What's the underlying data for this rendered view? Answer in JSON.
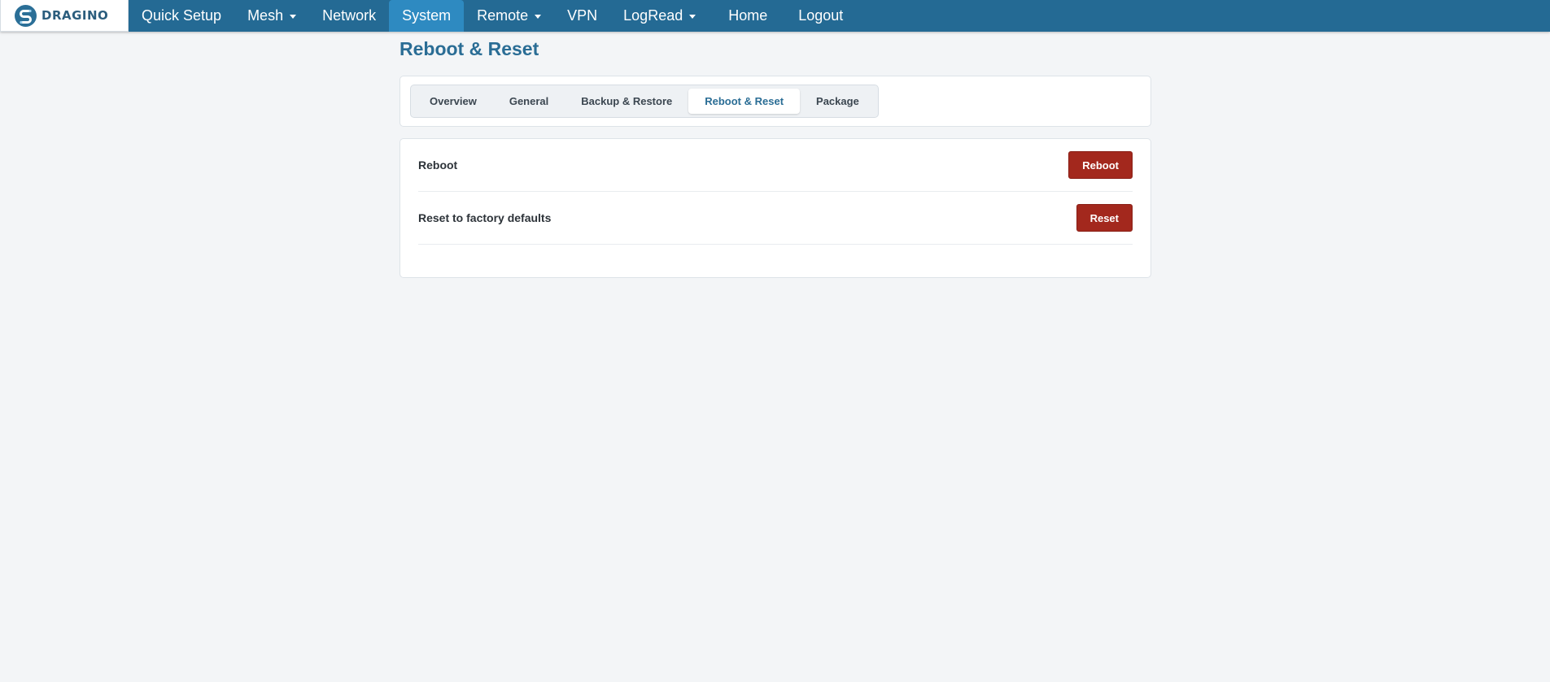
{
  "brand": {
    "logo_text": "DRAGINO"
  },
  "navbar": {
    "items": [
      {
        "label": "Quick Setup",
        "dropdown": false
      },
      {
        "label": "Mesh",
        "dropdown": true
      },
      {
        "label": "Network",
        "dropdown": false
      },
      {
        "label": "System",
        "dropdown": false,
        "active": true
      },
      {
        "label": "Remote",
        "dropdown": true
      },
      {
        "label": "VPN",
        "dropdown": false
      },
      {
        "label": "LogRead",
        "dropdown": true
      },
      {
        "label": "Home",
        "dropdown": false
      },
      {
        "label": "Logout",
        "dropdown": false
      }
    ]
  },
  "page": {
    "title": "Reboot & Reset"
  },
  "tabs": [
    {
      "label": "Overview"
    },
    {
      "label": "General"
    },
    {
      "label": "Backup & Restore"
    },
    {
      "label": "Reboot & Reset",
      "active": true
    },
    {
      "label": "Package"
    }
  ],
  "settings": [
    {
      "label": "Reboot",
      "button": "Reboot"
    },
    {
      "label": "Reset to factory defaults",
      "button": "Reset"
    }
  ],
  "colors": {
    "navbar": "#246a94",
    "nav_active": "#2e8ac1",
    "title": "#2a6d95",
    "danger_button": "#a3281d",
    "background": "#f3f5f7"
  }
}
